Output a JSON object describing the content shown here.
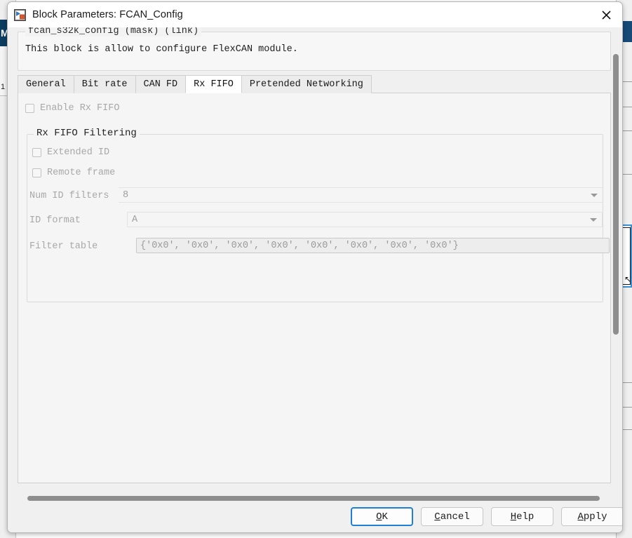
{
  "background": {
    "left_label": "M",
    "left_row_number": "1"
  },
  "dialog": {
    "title": "Block Parameters: FCAN_Config",
    "title_icon": "simulink-block-icon",
    "close_icon": "close-icon",
    "mask": {
      "legend": "fcan_s32k_config (mask) (link)",
      "description": "This block is allow to configure FlexCAN module."
    },
    "tabs": [
      {
        "label": "General",
        "active": false
      },
      {
        "label": "Bit rate",
        "active": false
      },
      {
        "label": "CAN FD",
        "active": false
      },
      {
        "label": "Rx FIFO",
        "active": true
      },
      {
        "label": "Pretended Networking",
        "active": false
      }
    ],
    "panel": {
      "enable_rx_fifo": {
        "label": "Enable Rx FIFO",
        "checked": false,
        "enabled": false
      },
      "filtering_group": {
        "legend": "Rx FIFO Filtering",
        "extended_id": {
          "label": "Extended ID",
          "checked": false,
          "enabled": false
        },
        "remote_frame": {
          "label": "Remote frame",
          "checked": false,
          "enabled": false
        },
        "num_id_filters": {
          "label": "Num ID filters",
          "value": "8",
          "enabled": false,
          "arrow_icon": "chevron-down-icon"
        },
        "id_format": {
          "label": "ID format",
          "value": "A",
          "enabled": false,
          "arrow_icon": "chevron-down-icon"
        },
        "filter_table": {
          "label": "Filter table",
          "value": "{'0x0', '0x0', '0x0', '0x0', '0x0', '0x0', '0x0', '0x0'}",
          "enabled": false,
          "edit_icon": "vertical-dots-icon"
        }
      }
    },
    "footer": {
      "ok": {
        "prefix": "",
        "mnemonic": "O",
        "suffix": "K"
      },
      "cancel": {
        "prefix": "",
        "mnemonic": "C",
        "suffix": "ancel"
      },
      "help": {
        "prefix": "",
        "mnemonic": "H",
        "suffix": "elp"
      },
      "apply": {
        "prefix": "",
        "mnemonic": "A",
        "suffix": "pply"
      }
    },
    "scrollbars": {
      "vertical_visible": true,
      "horizontal_visible": true
    }
  },
  "colors": {
    "accent_blue": "#1f7fd4",
    "dialog_bg": "#f0f0f0",
    "panel_bg": "#f5f5f5",
    "disabled_text": "#a8a8a8",
    "matlab_blue": "#0d3c61"
  }
}
